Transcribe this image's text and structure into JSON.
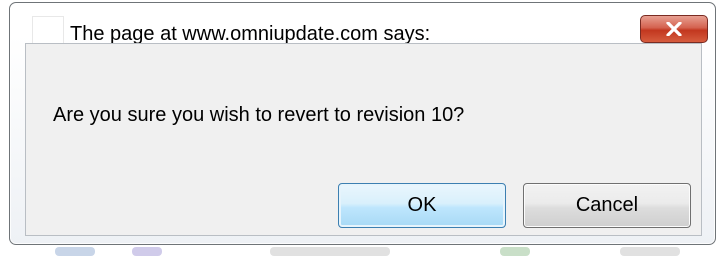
{
  "dialog": {
    "title": "The page at www.omniupdate.com says:",
    "message": "Are you sure you wish to revert to revision 10?",
    "ok_label": "OK",
    "cancel_label": "Cancel",
    "close_icon": "close-icon",
    "app_icon": "page-icon"
  },
  "colors": {
    "close_button": "#c2371f",
    "ok_border": "#3c7fb1",
    "content_background": "#f0f0f0"
  }
}
